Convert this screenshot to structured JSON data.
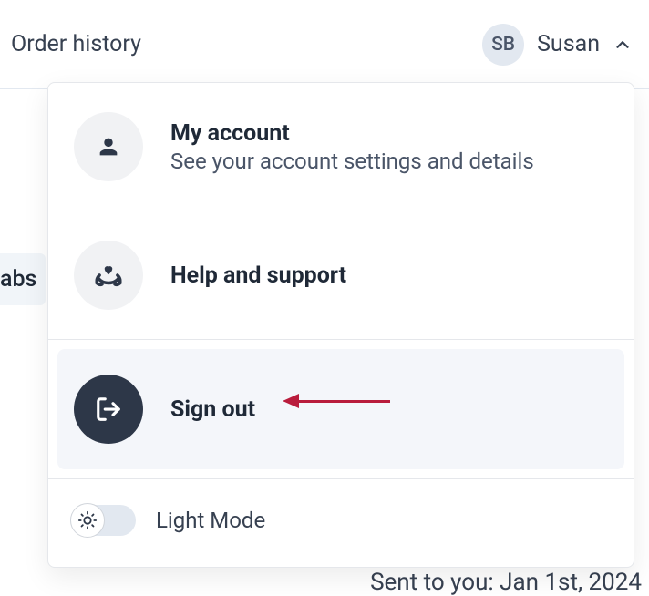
{
  "header": {
    "title": "Order history",
    "user": {
      "initials": "SB",
      "name": "Susan"
    }
  },
  "tab_partial": "abs",
  "menu": {
    "account": {
      "title": "My account",
      "subtitle": "See your account settings and details"
    },
    "help": {
      "title": "Help and support"
    },
    "signout": {
      "title": "Sign out"
    },
    "theme": {
      "label": "Light Mode"
    }
  },
  "background": {
    "sent_line": "Sent to you: Jan 1st, 2024"
  }
}
